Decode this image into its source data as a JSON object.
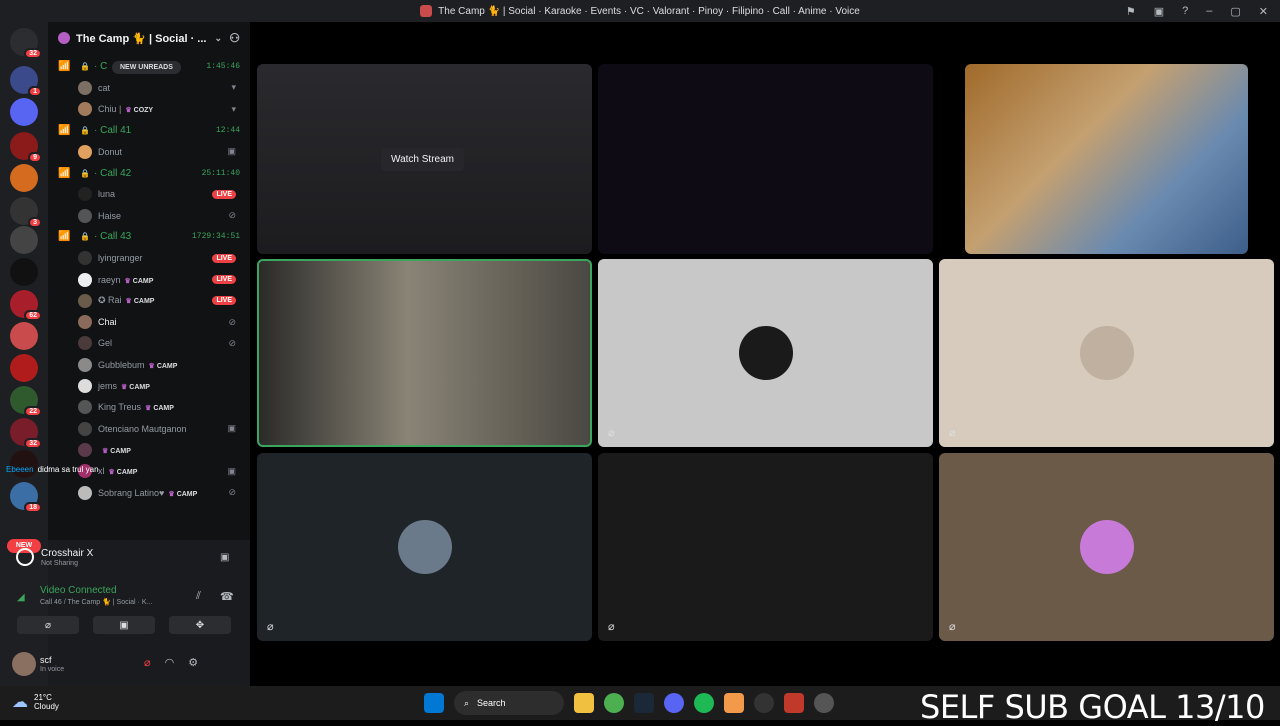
{
  "window": {
    "title": "The Camp 🐈 | Social · Karaoke · Events · VC · Valorant · Pinoy · Filipino · Call · Anime · Voice"
  },
  "servers": [
    {
      "color": "#2b2d31",
      "badge": "32"
    },
    {
      "color": "#3a4a8a",
      "badge": "1"
    },
    {
      "color": "#5865f2",
      "badge": ""
    },
    {
      "color": "#8b1a1a",
      "badge": "9"
    },
    {
      "color": "#d46b1e",
      "badge": ""
    },
    {
      "color": "#333333",
      "badge": "3"
    },
    {
      "color": "#444444",
      "badge": ""
    },
    {
      "color": "#111111",
      "badge": ""
    },
    {
      "color": "#a81e2a",
      "badge": "62"
    },
    {
      "color": "#c94b4b",
      "badge": ""
    },
    {
      "color": "#b01c1c",
      "badge": ""
    },
    {
      "color": "#2e5a2e",
      "badge": "22"
    },
    {
      "color": "#7a1d2b",
      "badge": "32"
    },
    {
      "color": "#221111",
      "badge": ""
    },
    {
      "color": "#3a6ea5",
      "badge": "18"
    }
  ],
  "new_pill": "NEW",
  "sidebar": {
    "server_name": "The Camp 🐈 | Social · ...",
    "new_unreads": "NEW UNREADS",
    "rows": [
      {
        "kind": "vc",
        "name": "C",
        "time": "1:45:46"
      },
      {
        "kind": "user",
        "name": "cat",
        "tag": "",
        "live": false,
        "icon": "▾",
        "hl": false,
        "avatar": "#7c6f64"
      },
      {
        "kind": "user",
        "name": "Chiu |",
        "tag": "COZY",
        "live": false,
        "icon": "▾",
        "hl": false,
        "avatar": "#a27b5c"
      },
      {
        "kind": "vc",
        "name": "Call 41",
        "time": "12:44"
      },
      {
        "kind": "user",
        "name": "Donut",
        "tag": "",
        "live": false,
        "icon": "▣",
        "hl": false,
        "avatar": "#e0a060"
      },
      {
        "kind": "vc",
        "name": "Call 42",
        "time": "25:11:40"
      },
      {
        "kind": "user",
        "name": "luna",
        "tag": "",
        "live": true,
        "icon": "",
        "hl": false,
        "avatar": "#222222"
      },
      {
        "kind": "user",
        "name": "Haise",
        "tag": "",
        "live": false,
        "icon": "⊘",
        "hl": false,
        "avatar": "#555555"
      },
      {
        "kind": "vc",
        "name": "Call 43",
        "time": "1729:34:51"
      },
      {
        "kind": "user",
        "name": "lyingranger",
        "tag": "",
        "live": true,
        "icon": "",
        "hl": false,
        "avatar": "#333333"
      },
      {
        "kind": "user",
        "name": "raeyn",
        "tag": "CAMP",
        "live": true,
        "icon": "",
        "hl": false,
        "avatar": "#eeeeee"
      },
      {
        "kind": "user",
        "name": "✪ Rai",
        "tag": "CAMP",
        "live": true,
        "icon": "",
        "hl": false,
        "avatar": "#6b5b4b"
      },
      {
        "kind": "user",
        "name": "Chai",
        "tag": "",
        "live": false,
        "icon": "⊘",
        "hl": true,
        "avatar": "#8a6a5a"
      },
      {
        "kind": "user",
        "name": "Gel",
        "tag": "",
        "live": false,
        "icon": "⊘",
        "hl": false,
        "avatar": "#4a3a3a"
      },
      {
        "kind": "user",
        "name": "Gubblebum",
        "tag": "CAMP",
        "live": false,
        "icon": "",
        "hl": false,
        "avatar": "#8a8a8a"
      },
      {
        "kind": "user",
        "name": "jems",
        "tag": "CAMP",
        "live": false,
        "icon": "",
        "hl": false,
        "avatar": "#dddddd"
      },
      {
        "kind": "user",
        "name": "King Treus",
        "tag": "CAMP",
        "live": false,
        "icon": "",
        "hl": false,
        "avatar": "#555555"
      },
      {
        "kind": "user",
        "name": "Otenciano Mautganon",
        "tag": "",
        "live": false,
        "icon": "▣",
        "hl": false,
        "avatar": "#444444"
      },
      {
        "kind": "user",
        "name": "",
        "tag": "CAMP",
        "live": false,
        "icon": "",
        "hl": false,
        "avatar": "#5a3a4a"
      },
      {
        "kind": "user",
        "name": "xl",
        "tag": "CAMP",
        "live": false,
        "icon": "▣",
        "hl": false,
        "avatar": "#a0306a"
      },
      {
        "kind": "user",
        "name": "Sobrang Latino♥",
        "tag": "CAMP",
        "live": false,
        "icon": "⊘",
        "hl": false,
        "avatar": "#bbbbbb"
      }
    ]
  },
  "overlay_chat": {
    "name": "Ebeeen",
    "text": "didma sa trul yan"
  },
  "activity": {
    "title": "Crosshair X",
    "subtitle": "Not Sharing"
  },
  "voice": {
    "status": "Video Connected",
    "channel": "Call 46 / The Camp 🐈 | Social · K..."
  },
  "controls": {
    "camera": "⌀",
    "screen": "▣",
    "activity": "✥"
  },
  "user": {
    "name": "scf",
    "status": "In voice"
  },
  "tiles": [
    {
      "kind": "stream",
      "label": "Watch Stream"
    },
    {
      "kind": "dark"
    },
    {
      "kind": "webcam"
    },
    {
      "kind": "webcam-selected"
    },
    {
      "kind": "avatar",
      "bg": "#c8c8c8",
      "avatar": "#1a1a1a"
    },
    {
      "kind": "avatar",
      "bg": "#d6cbbd",
      "avatar": "#c0b0a0"
    },
    {
      "kind": "avatar",
      "bg": "#1f2429",
      "avatar": "#6a7a8a"
    },
    {
      "kind": "empty",
      "bg": "#1a1a1a"
    },
    {
      "kind": "avatar",
      "bg": "#6b5a47",
      "avatar": "#c77ad8"
    }
  ],
  "taskbar": {
    "temp": "21°C",
    "weather": "Cloudy",
    "search": "Search",
    "goal_text": "SELF SUB GOAL 13/10"
  }
}
